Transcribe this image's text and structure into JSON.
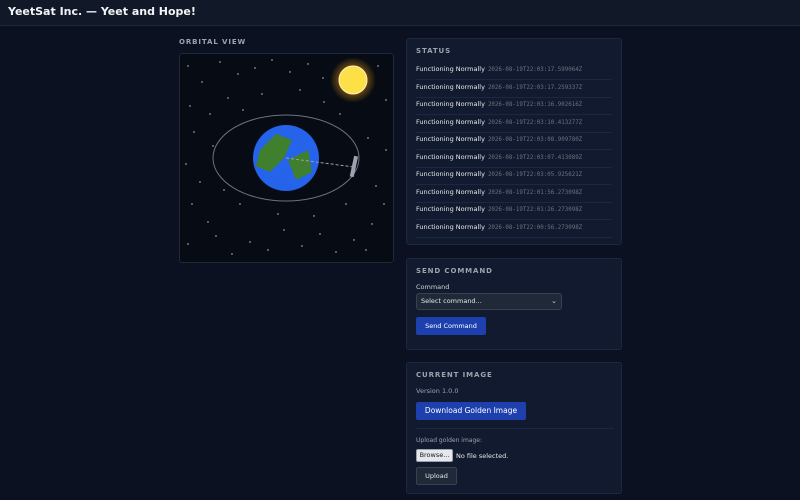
{
  "app": {
    "title": "YeetSat Inc. — Yeet and Hope!"
  },
  "orbital": {
    "label": "ORBITAL VIEW"
  },
  "status": {
    "title": "STATUS",
    "entries": [
      {
        "text": "Functioning Normally",
        "time": "2026-08-19T22:03:17.599064Z"
      },
      {
        "text": "Functioning Normally",
        "time": "2026-08-19T22:03:17.259337Z"
      },
      {
        "text": "Functioning Normally",
        "time": "2026-08-19T22:03:16.902616Z"
      },
      {
        "text": "Functioning Normally",
        "time": "2026-08-19T22:03:10.413277Z"
      },
      {
        "text": "Functioning Normally",
        "time": "2026-08-19T22:03:08.909780Z"
      },
      {
        "text": "Functioning Normally",
        "time": "2026-08-19T22:03:07.413089Z"
      },
      {
        "text": "Functioning Normally",
        "time": "2026-08-19T22:03:05.925621Z"
      },
      {
        "text": "Functioning Normally",
        "time": "2026-08-19T22:01:56.273098Z"
      },
      {
        "text": "Functioning Normally",
        "time": "2026-08-19T22:01:26.273098Z"
      },
      {
        "text": "Functioning Normally",
        "time": "2026-08-19T22:00:56.273098Z"
      }
    ]
  },
  "command": {
    "title": "SEND COMMAND",
    "field_label": "Command",
    "select_value": "Select command...",
    "send_label": "Send Command"
  },
  "image": {
    "title": "CURRENT IMAGE",
    "version": "Version 1.0.0",
    "download_label": "Download Golden Image",
    "upload_label": "Upload golden image:",
    "browse_label": "Browse...",
    "no_file": "No file selected.",
    "upload_button": "Upload"
  },
  "icons": {
    "select_arrow": "chevron-down-icon"
  },
  "colors": {
    "accent": "#1e40af",
    "background": "#0b1120",
    "card": "#111a2e"
  }
}
